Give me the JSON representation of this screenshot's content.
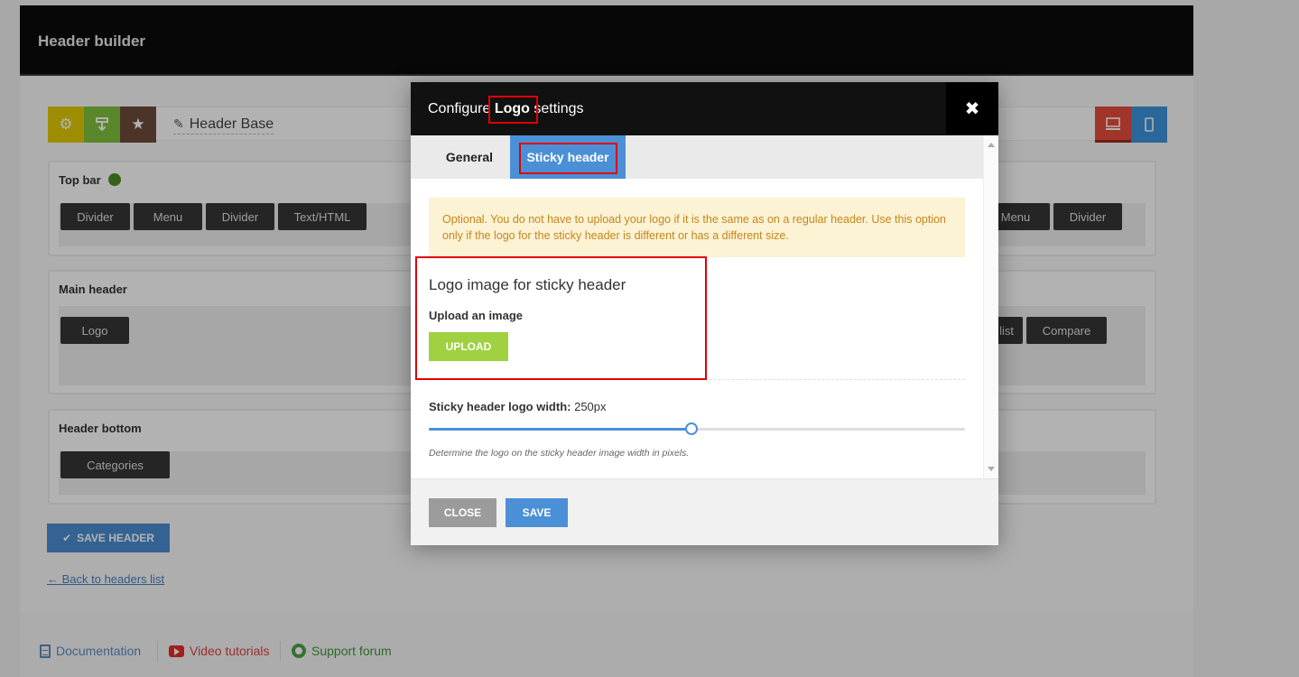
{
  "page": {
    "title": "Header builder",
    "toolbar": {
      "header_name": "Header Base",
      "icons": [
        "gear-icon",
        "import-icon",
        "star-icon",
        "pencil-icon",
        "desktop-icon",
        "mobile-icon"
      ]
    },
    "sections": {
      "top_bar": {
        "title": "Top bar",
        "left_elements": [
          "Divider",
          "Menu",
          "Divider",
          "Text/HTML"
        ],
        "right_elements": [
          "Menu",
          "Divider"
        ]
      },
      "main_header": {
        "title": "Main header",
        "left_elements": [
          "Logo"
        ],
        "right_elements": [
          "list",
          "Compare"
        ]
      },
      "header_bottom": {
        "title": "Header bottom",
        "left_elements": [
          "Categories"
        ]
      }
    },
    "save_header_label": "SAVE HEADER",
    "back_link": "← Back to headers list",
    "footer": {
      "documentation": "Documentation",
      "video_tutorials": "Video tutorials",
      "support_forum": "Support forum"
    }
  },
  "modal": {
    "title_prefix": "Configure ",
    "title_bold": "Logo",
    "title_suffix": " settings",
    "tabs": {
      "general": "General",
      "sticky": "Sticky header"
    },
    "notice": "Optional. You do not have to upload your logo if it is the same as on a regular header. Use this option only if the logo for the sticky header is different or has a different size.",
    "logo_field": {
      "title": "Logo image for sticky header",
      "subtitle": "Upload an image",
      "upload_label": "UPLOAD"
    },
    "width_field": {
      "label": "Sticky header logo width:",
      "value": "250px",
      "value_fraction": 0.49,
      "help": "Determine the logo on the sticky header image width in pixels."
    },
    "buttons": {
      "close": "CLOSE",
      "save": "SAVE"
    }
  },
  "colors": {
    "accent_blue": "#4b90d6",
    "upload_green": "#9fd140",
    "notice_bg": "#fcf2d4",
    "highlight_red": "#e00000"
  }
}
